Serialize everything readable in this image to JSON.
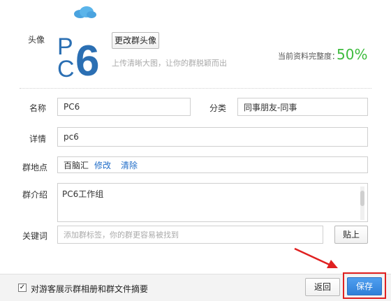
{
  "header": {
    "icon": "cloud-icon"
  },
  "avatar": {
    "label": "头像",
    "logo_text": "PC6",
    "change_button": "更改群头像",
    "hint": "上传清晰大图，让你的群脱颖而出"
  },
  "completeness": {
    "label": "当前资料完整度：",
    "value": "50%"
  },
  "form": {
    "name": {
      "label": "名称",
      "value": "PC6"
    },
    "category": {
      "label": "分类",
      "value": "同事朋友-同事"
    },
    "detail": {
      "label": "详情",
      "value": "pc6"
    },
    "location": {
      "label": "群地点",
      "value": "百脑汇",
      "edit": "修改",
      "clear": "清除"
    },
    "intro": {
      "label": "群介绍",
      "value": "PC6工作组"
    },
    "keywords": {
      "label": "关键词",
      "placeholder": "添加群标签，你的群更容易被找到",
      "paste": "贴上"
    }
  },
  "footer": {
    "checkbox_label": "对游客展示群相册和群文件摘要",
    "checked": true,
    "back_button": "返回",
    "save_button": "保存"
  },
  "colors": {
    "accent_green": "#3dbb3d",
    "primary_blue": "#3a8ee6",
    "highlight_red": "#e02020",
    "link_blue": "#1f6cc8"
  }
}
